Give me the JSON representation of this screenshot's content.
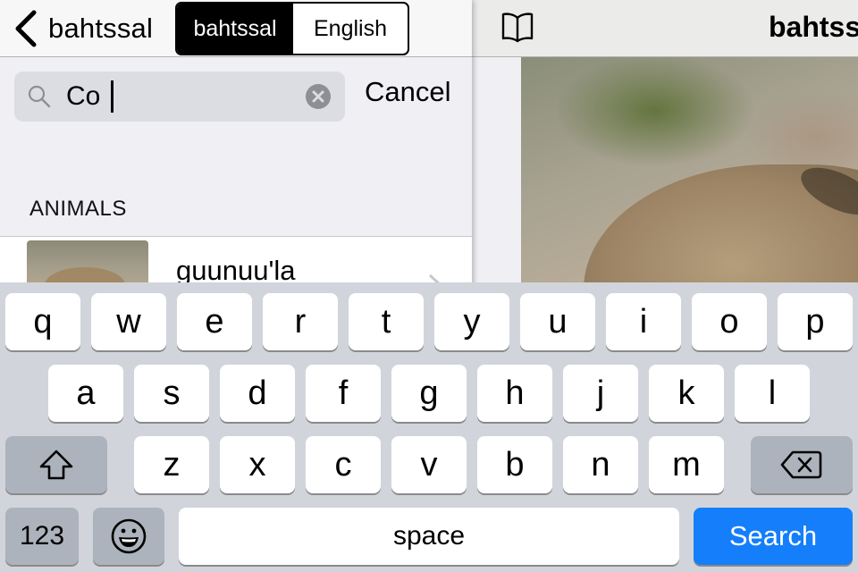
{
  "left_nav": {
    "back_label": "bahtssal",
    "segments": [
      {
        "label": "bahtssal",
        "selected": true
      },
      {
        "label": "English",
        "selected": false
      }
    ]
  },
  "search": {
    "value": "Co",
    "placeholder": "",
    "cancel_label": "Cancel"
  },
  "results": {
    "section_header": "ANIMALS",
    "items": [
      {
        "title": "guunuu'la",
        "thumbnail": "coyote-photo"
      }
    ]
  },
  "detail": {
    "title": "bahtss",
    "image": "coyote-photo"
  },
  "keyboard": {
    "row1": [
      "q",
      "w",
      "e",
      "r",
      "t",
      "y",
      "u",
      "i",
      "o",
      "p"
    ],
    "row2": [
      "a",
      "s",
      "d",
      "f",
      "g",
      "h",
      "j",
      "k",
      "l"
    ],
    "row3": [
      "z",
      "x",
      "c",
      "v",
      "b",
      "n",
      "m"
    ],
    "numbers_label": "123",
    "space_label": "space",
    "search_label": "Search",
    "icons": {
      "shift": "shift-icon",
      "backspace": "backspace-icon",
      "emoji": "emoji-icon"
    }
  },
  "colors": {
    "accent": "#147efb",
    "keyboard_bg": "#d1d5db",
    "function_key": "#adb3bc"
  }
}
